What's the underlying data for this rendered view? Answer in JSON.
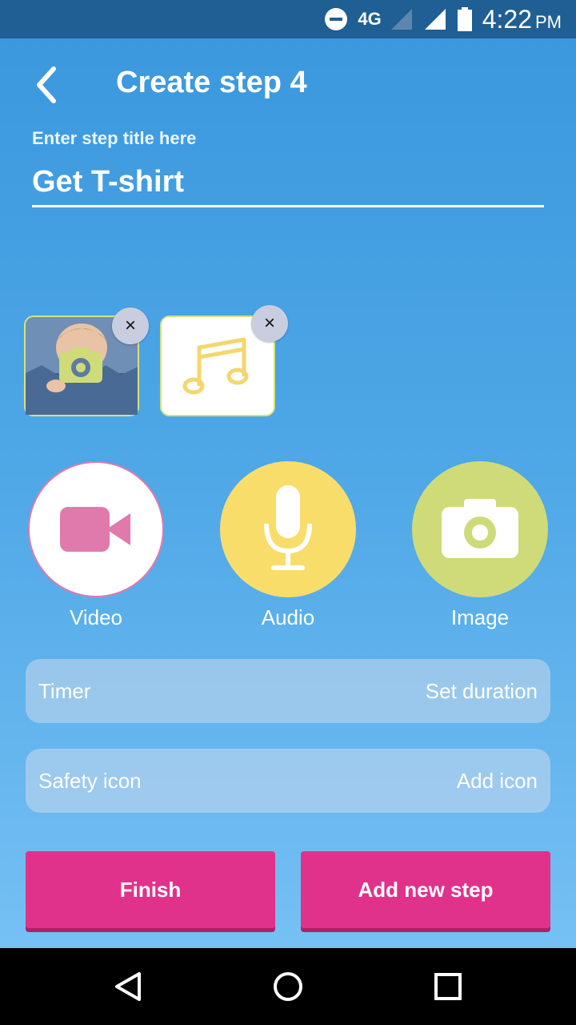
{
  "status_bar": {
    "network": "4G",
    "time": "4:22",
    "ampm": "PM"
  },
  "header": {
    "title": "Create step 4"
  },
  "step_title_field": {
    "label": "Enter step title here",
    "value": "Get T-shirt"
  },
  "media_buttons": [
    {
      "label": "Video",
      "icon": "video-camera-icon",
      "color": "#e07aac"
    },
    {
      "label": "Audio",
      "icon": "microphone-icon",
      "color": "#f9dd6b"
    },
    {
      "label": "Image",
      "icon": "camera-icon",
      "color": "#cfdb79"
    }
  ],
  "attachments": [
    {
      "type": "image",
      "remove_label": "×"
    },
    {
      "type": "audio",
      "remove_label": "×"
    }
  ],
  "settings_rows": [
    {
      "label": "Timer",
      "action": "Set duration"
    },
    {
      "label": "Safety icon",
      "action": "Add icon"
    }
  ],
  "buttons": {
    "finish": "Finish",
    "add_step": "Add new step"
  },
  "colors": {
    "accent": "#e0328a",
    "status_bar": "#1f5f93"
  }
}
